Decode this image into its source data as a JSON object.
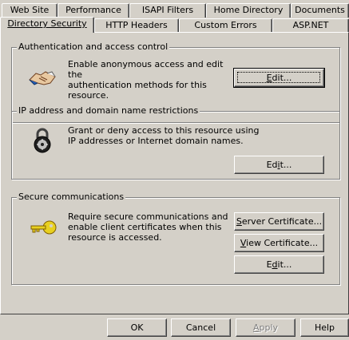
{
  "tabs_row1": [
    {
      "label": "Web Site"
    },
    {
      "label": "Performance"
    },
    {
      "label": "ISAPI Filters"
    },
    {
      "label": "Home Directory"
    },
    {
      "label": "Documents"
    }
  ],
  "tabs_row2": [
    {
      "label": "Directory Security",
      "active": true
    },
    {
      "label": "HTTP Headers"
    },
    {
      "label": "Custom Errors"
    },
    {
      "label": "ASP.NET"
    }
  ],
  "auth": {
    "title": "Authentication and access control",
    "desc_line1": "Enable anonymous access and edit the",
    "desc_line2": "authentication methods for this resource.",
    "edit_u": "E",
    "edit_rest": "dit...",
    "icon": "handshake-icon"
  },
  "ip": {
    "title": "IP address and domain name restrictions",
    "desc_line1": "Grant or deny access to this resource using",
    "desc_line2": "IP addresses or Internet domain names.",
    "edit_pre": "Ed",
    "edit_u": "i",
    "edit_post": "t...",
    "icon": "padlock-icon"
  },
  "secure": {
    "title": "Secure communications",
    "desc_line1": "Require secure communications and",
    "desc_line2": "enable client certificates when this",
    "desc_line3": "resource is accessed.",
    "server_u": "S",
    "server_rest": "erver Certificate...",
    "view_u": "V",
    "view_rest": "iew Certificate...",
    "edit_pre": "E",
    "edit_u": "d",
    "edit_post": "it...",
    "icon": "key-icon"
  },
  "footer": {
    "ok": "OK",
    "cancel": "Cancel",
    "apply_u": "A",
    "apply_rest": "pply",
    "help": "Help"
  }
}
